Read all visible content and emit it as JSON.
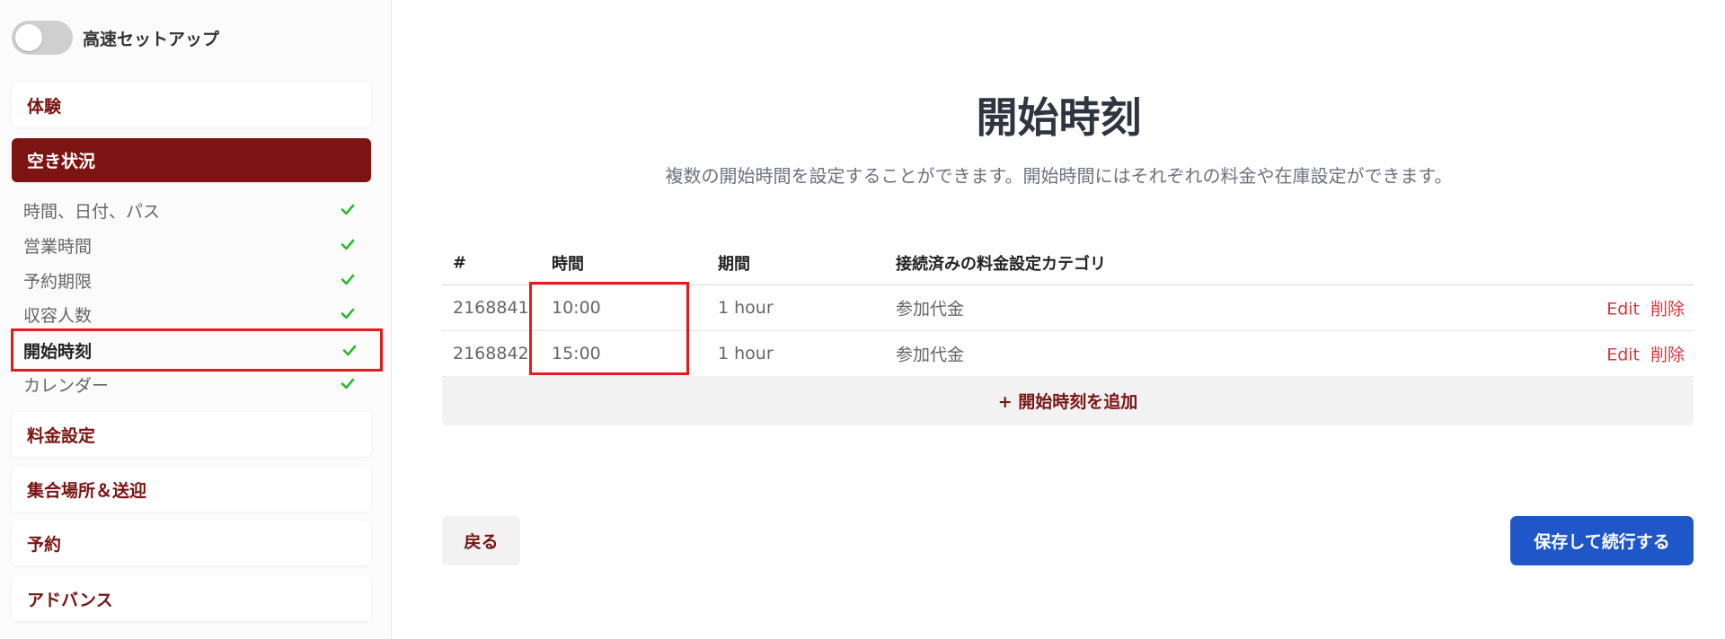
{
  "sidebar": {
    "fast_setup_label": "高速セットアップ",
    "sections": {
      "experience": "体験",
      "availability": "空き状況",
      "pricing": "料金設定",
      "meeting": "集合場所＆送迎",
      "booking": "予約",
      "advanced": "アドバンス"
    },
    "availability_items": [
      {
        "label": "時間、日付、パス",
        "done": true
      },
      {
        "label": "営業時間",
        "done": true
      },
      {
        "label": "予約期限",
        "done": true
      },
      {
        "label": "収容人数",
        "done": true
      },
      {
        "label": "開始時刻",
        "done": true
      },
      {
        "label": "カレンダー",
        "done": true
      }
    ],
    "accent_color": "#7d1414",
    "check_color": "#2eb82e"
  },
  "main": {
    "title": "開始時刻",
    "description": "複数の開始時間を設定することができます。開始時間にはそれぞれの料金や在庫設定ができます。",
    "table": {
      "headers": {
        "id": "#",
        "time": "時間",
        "duration": "期間",
        "category": "接続済みの料金設定カテゴリ"
      },
      "rows": [
        {
          "id": "2168841",
          "time": "10:00",
          "duration": "1 hour",
          "category": "参加代金",
          "edit": "Edit",
          "delete": "削除"
        },
        {
          "id": "2168842",
          "time": "15:00",
          "duration": "1 hour",
          "category": "参加代金",
          "edit": "Edit",
          "delete": "削除"
        }
      ]
    },
    "add_button": "+ 開始時刻を追加",
    "back_button": "戻る",
    "save_button": "保存して続行する",
    "primary_color": "#1f57c9"
  }
}
